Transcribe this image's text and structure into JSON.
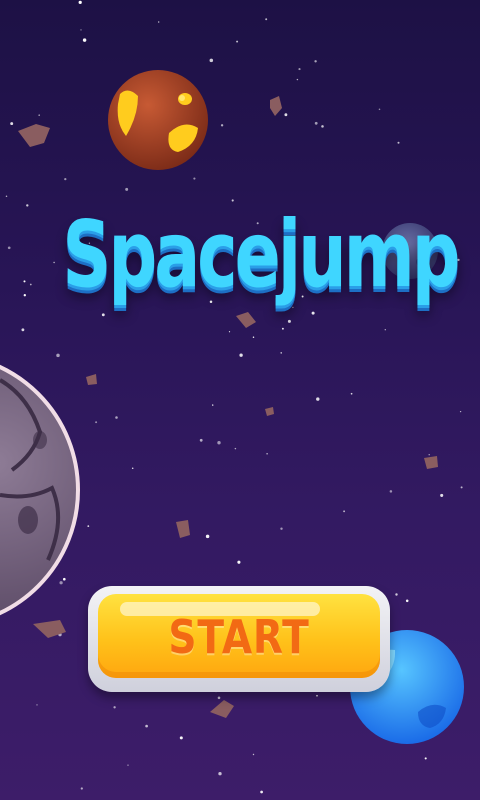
{
  "screen": "title",
  "title": "Spacejump",
  "start_button": {
    "label": "START"
  },
  "colors": {
    "background_top": "#1d1145",
    "background_bottom": "#3d1d69",
    "title": "#3fd6ff",
    "button_fill": "#ffc21a",
    "button_text": "#f26a14"
  }
}
